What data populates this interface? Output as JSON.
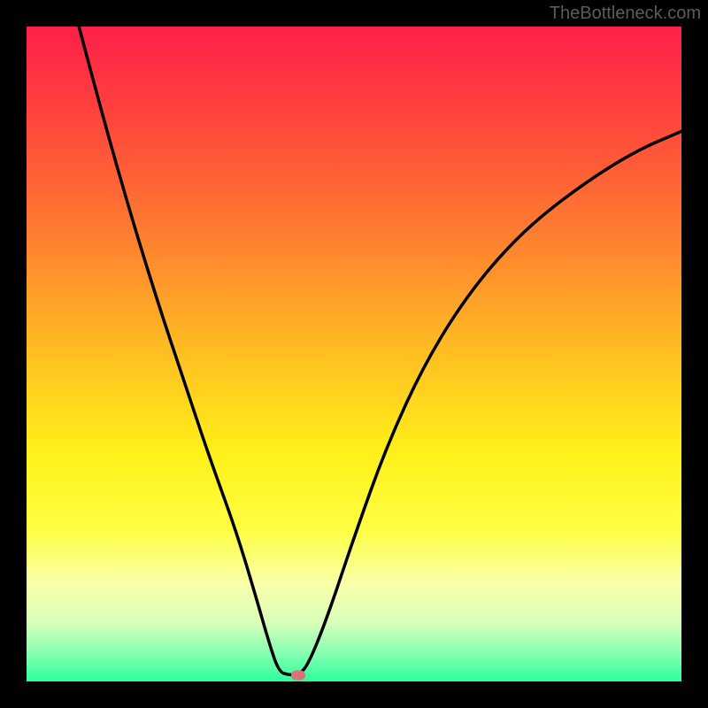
{
  "watermark": "TheBottleneck.com",
  "chart_data": {
    "type": "line",
    "title": "",
    "xlabel": "",
    "ylabel": "",
    "xlim": [
      0,
      100
    ],
    "ylim": [
      0,
      100
    ],
    "background_gradient": {
      "stops": [
        {
          "pos": 0.0,
          "color": "#ff1f49"
        },
        {
          "pos": 0.16,
          "color": "#ff4b3b"
        },
        {
          "pos": 0.33,
          "color": "#ff822f"
        },
        {
          "pos": 0.5,
          "color": "#ffbf22"
        },
        {
          "pos": 0.65,
          "color": "#fff019"
        },
        {
          "pos": 0.77,
          "color": "#fdff44"
        },
        {
          "pos": 0.85,
          "color": "#faffaa"
        },
        {
          "pos": 0.91,
          "color": "#d9ffb9"
        },
        {
          "pos": 0.96,
          "color": "#7fffb0"
        },
        {
          "pos": 1.0,
          "color": "#2bff9c"
        }
      ]
    },
    "series": [
      {
        "name": "bottleneck-curve",
        "color": "#000000",
        "points": [
          {
            "x": 8.0,
            "y": 100.0
          },
          {
            "x": 12.0,
            "y": 85.0
          },
          {
            "x": 16.0,
            "y": 71.0
          },
          {
            "x": 20.0,
            "y": 58.0
          },
          {
            "x": 24.0,
            "y": 46.0
          },
          {
            "x": 28.0,
            "y": 34.0
          },
          {
            "x": 32.0,
            "y": 23.0
          },
          {
            "x": 35.0,
            "y": 13.0
          },
          {
            "x": 37.0,
            "y": 6.0
          },
          {
            "x": 38.5,
            "y": 1.5
          },
          {
            "x": 40.0,
            "y": 1.0
          },
          {
            "x": 41.5,
            "y": 1.0
          },
          {
            "x": 43.0,
            "y": 2.5
          },
          {
            "x": 46.0,
            "y": 10.0
          },
          {
            "x": 50.0,
            "y": 22.0
          },
          {
            "x": 55.0,
            "y": 36.0
          },
          {
            "x": 61.0,
            "y": 49.0
          },
          {
            "x": 68.0,
            "y": 60.0
          },
          {
            "x": 76.0,
            "y": 69.0
          },
          {
            "x": 85.0,
            "y": 76.0
          },
          {
            "x": 93.0,
            "y": 81.0
          },
          {
            "x": 100.0,
            "y": 84.0
          }
        ]
      }
    ],
    "marker": {
      "x": 41.5,
      "y": 1.0,
      "color": "#d9737a"
    }
  }
}
